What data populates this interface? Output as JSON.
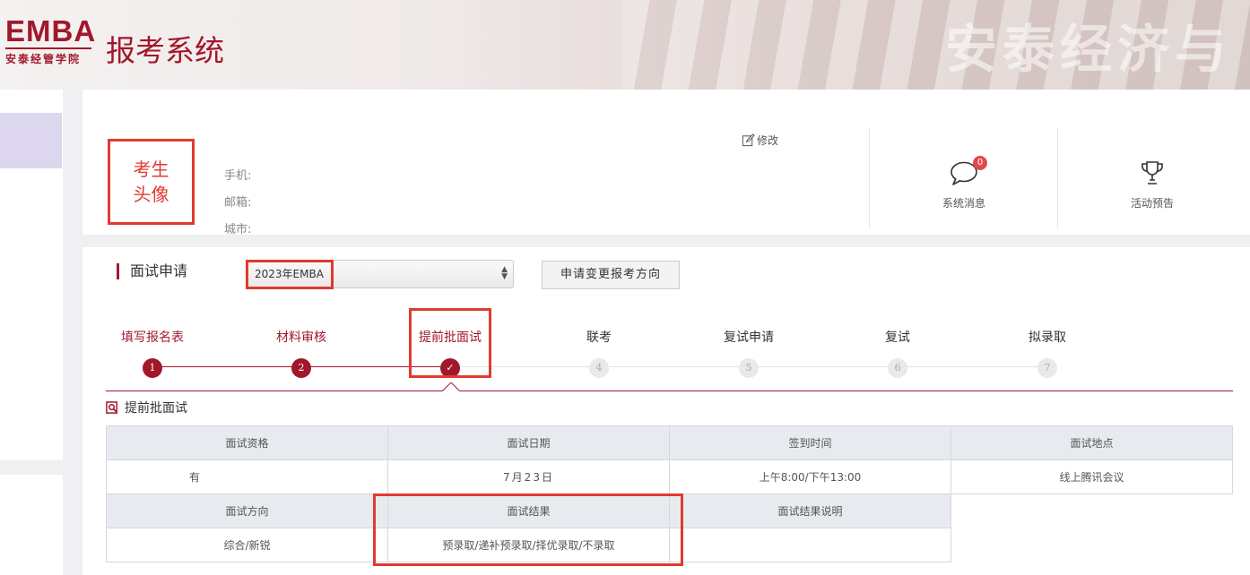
{
  "header": {
    "logo_main": "EMBA",
    "logo_school": "安泰经管学院",
    "system_title": "报考系统",
    "bg_text": "安泰经济与"
  },
  "profile": {
    "avatar_text": [
      "考生",
      "头像"
    ],
    "phone_label": "手机:",
    "email_label": "邮箱:",
    "city_label": "城市:",
    "edit_label": "修改",
    "messages": {
      "label": "系统消息",
      "badge": "0",
      "icon": "chat-bubble-icon"
    },
    "events": {
      "label": "活动预告",
      "icon": "trophy-icon"
    }
  },
  "interview": {
    "section_title": "面试申请",
    "select_value": "2023年EMBA",
    "change_button": "申请变更报考方向",
    "steps": [
      {
        "label": "填写报名表",
        "num": "1",
        "state": "done"
      },
      {
        "label": "材料审核",
        "num": "2",
        "state": "done"
      },
      {
        "label": "提前批面试",
        "num": "✓",
        "state": "done"
      },
      {
        "label": "联考",
        "num": "4",
        "state": "todo"
      },
      {
        "label": "复试申请",
        "num": "5",
        "state": "todo"
      },
      {
        "label": "复试",
        "num": "6",
        "state": "todo"
      },
      {
        "label": "拟录取",
        "num": "7",
        "state": "todo"
      }
    ],
    "sub_title": "提前批面试",
    "table": {
      "row1_headers": [
        "面试资格",
        "面试日期",
        "签到时间",
        "面试地点"
      ],
      "row1_values": [
        "有",
        "7月23日",
        "上午8:00/下午13:00",
        "线上腾讯会议"
      ],
      "row2_headers": [
        "面试方向",
        "面试结果",
        "面试结果说明"
      ],
      "row2_values": [
        "综合/新锐",
        "预录取/递补预录取/择优录取/不录取",
        ""
      ]
    }
  },
  "colors": {
    "brand": "#a1182b",
    "highlight": "#e03a2f"
  }
}
